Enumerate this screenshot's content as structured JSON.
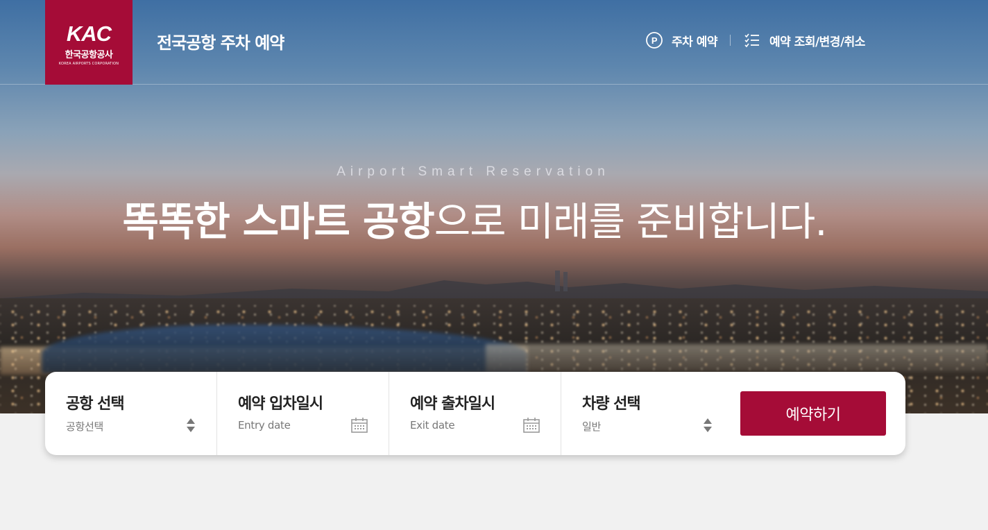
{
  "header": {
    "logo": {
      "mark": "KAC",
      "name_ko": "한국공항공사",
      "name_en": "KOREA AIRPORTS CORPORATION"
    },
    "title": "전국공항 주차 예약",
    "nav": [
      {
        "label": "주차 예약",
        "icon": "parking-circle-icon"
      },
      {
        "label": "예약 조회/변경/취소",
        "icon": "checklist-icon"
      }
    ]
  },
  "hero": {
    "subtitle": "Airport Smart Reservation",
    "headline_bold": "똑똑한 스마트 공항",
    "headline_light": "으로 미래를 준비합니다."
  },
  "form": {
    "airport": {
      "label": "공항 선택",
      "value": "공항선택",
      "icon": "sort-arrows-icon"
    },
    "entry": {
      "label": "예약 입차일시",
      "placeholder": "Entry date",
      "icon": "calendar-icon"
    },
    "exit": {
      "label": "예약 출차일시",
      "placeholder": "Exit date",
      "icon": "calendar-icon"
    },
    "vehicle": {
      "label": "차량 선택",
      "value": "일반",
      "icon": "sort-arrows-icon"
    },
    "submit_label": "예약하기"
  },
  "colors": {
    "brand": "#a50c37",
    "background": "#f1f1f1"
  }
}
